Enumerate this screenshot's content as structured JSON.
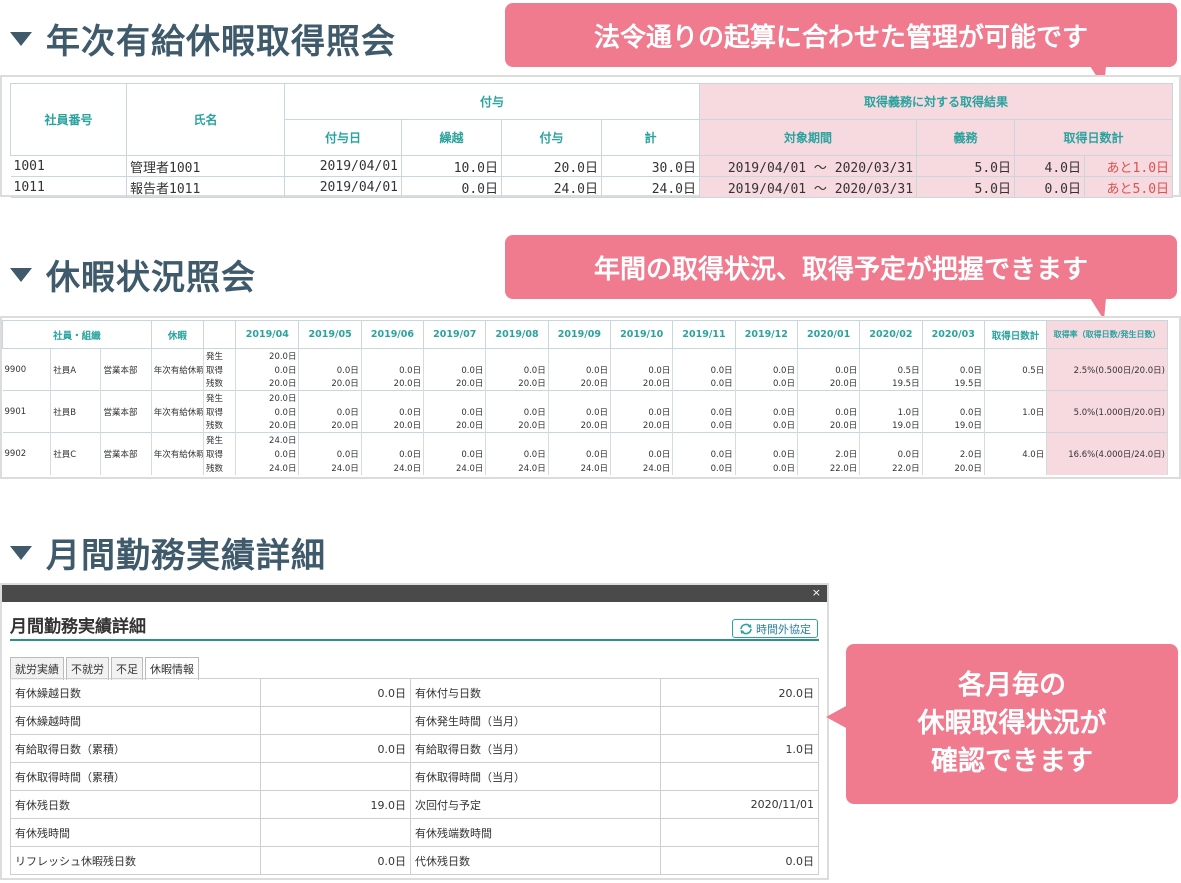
{
  "section1": {
    "title": "年次有給休暇取得照会",
    "callout": "法令通りの起算に合わせた管理が可能です",
    "headers": {
      "emp_no": "社員番号",
      "name": "氏名",
      "grant": "付与",
      "obligation_result": "取得義務に対する取得結果",
      "grant_date": "付与日",
      "carryover": "繰越",
      "granted": "付与",
      "total": "計",
      "period": "対象期間",
      "obligation": "義務",
      "taken_days": "取得日数計"
    },
    "rows": [
      {
        "emp_no": "1001",
        "name": "管理者1001",
        "grant_date": "2019/04/01",
        "carryover": "10.0日",
        "granted": "20.0日",
        "total": "30.0日",
        "period": "2019/04/01 ～ 2020/03/31",
        "obligation": "5.0日",
        "taken": "4.0日",
        "remaining": "あと1.0日"
      },
      {
        "emp_no": "1011",
        "name": "報告者1011",
        "grant_date": "2019/04/01",
        "carryover": "0.0日",
        "granted": "24.0日",
        "total": "24.0日",
        "period": "2019/04/01 ～ 2020/03/31",
        "obligation": "5.0日",
        "taken": "0.0日",
        "remaining": "あと5.0日"
      }
    ]
  },
  "section2": {
    "title": "休暇状況照会",
    "callout": "年間の取得状況、取得予定が把握できます",
    "headers": {
      "emp_org": "社員・組織",
      "leave": "休暇",
      "months": [
        "2019/04",
        "2019/05",
        "2019/06",
        "2019/07",
        "2019/08",
        "2019/09",
        "2019/10",
        "2019/11",
        "2019/12",
        "2020/01",
        "2020/02",
        "2020/03"
      ],
      "taken_total": "取得日数計",
      "rate": "取得率（取得日数/発生日数）"
    },
    "row_labels": [
      "発生",
      "取得",
      "残数"
    ],
    "employees": [
      {
        "code": "9900",
        "name": "社員A",
        "dept": "営業本部",
        "leave": "年次有給休暇",
        "occur": [
          "20.0日",
          "",
          "",
          "",
          "",
          "",
          "",
          "",
          "",
          "",
          "",
          ""
        ],
        "taken": [
          "0.0日",
          "0.0日",
          "0.0日",
          "0.0日",
          "0.0日",
          "0.0日",
          "0.0日",
          "0.0日",
          "0.0日",
          "0.0日",
          "0.5日",
          "0.0日"
        ],
        "remain": [
          "20.0日",
          "20.0日",
          "20.0日",
          "20.0日",
          "20.0日",
          "20.0日",
          "20.0日",
          "0.0日",
          "0.0日",
          "20.0日",
          "19.5日",
          "19.5日"
        ],
        "taken_total": "0.5日",
        "rate": "2.5%(0.500日/20.0日)"
      },
      {
        "code": "9901",
        "name": "社員B",
        "dept": "営業本部",
        "leave": "年次有給休暇",
        "occur": [
          "20.0日",
          "",
          "",
          "",
          "",
          "",
          "",
          "",
          "",
          "",
          "",
          ""
        ],
        "taken": [
          "0.0日",
          "0.0日",
          "0.0日",
          "0.0日",
          "0.0日",
          "0.0日",
          "0.0日",
          "0.0日",
          "0.0日",
          "0.0日",
          "1.0日",
          "0.0日"
        ],
        "remain": [
          "20.0日",
          "20.0日",
          "20.0日",
          "20.0日",
          "20.0日",
          "20.0日",
          "20.0日",
          "0.0日",
          "0.0日",
          "20.0日",
          "19.0日",
          "19.0日"
        ],
        "taken_total": "1.0日",
        "rate": "5.0%(1.000日/20.0日)"
      },
      {
        "code": "9902",
        "name": "社員C",
        "dept": "営業本部",
        "leave": "年次有給休暇",
        "occur": [
          "24.0日",
          "",
          "",
          "",
          "",
          "",
          "",
          "",
          "",
          "",
          "",
          ""
        ],
        "taken": [
          "0.0日",
          "0.0日",
          "0.0日",
          "0.0日",
          "0.0日",
          "0.0日",
          "0.0日",
          "0.0日",
          "0.0日",
          "2.0日",
          "0.0日",
          "2.0日"
        ],
        "remain": [
          "24.0日",
          "24.0日",
          "24.0日",
          "24.0日",
          "24.0日",
          "24.0日",
          "24.0日",
          "0.0日",
          "0.0日",
          "22.0日",
          "22.0日",
          "20.0日"
        ],
        "taken_total": "4.0日",
        "rate": "16.6%(4.000日/24.0日)"
      }
    ]
  },
  "section3": {
    "title": "月間勤務実績詳細",
    "callout_lines": [
      "各月毎の",
      "休暇取得状況が",
      "確認できます"
    ],
    "window": {
      "close": "×",
      "title": "月間勤務実績詳細",
      "overtime_button": "時間外協定",
      "tabs": [
        "就労実績",
        "不就労",
        "不足",
        "休暇情報"
      ],
      "rows": [
        [
          "有休繰越日数",
          "0.0日",
          "有休付与日数",
          "20.0日"
        ],
        [
          "有休繰越時間",
          "",
          "有休発生時間（当月）",
          ""
        ],
        [
          "有給取得日数（累積）",
          "0.0日",
          "有給取得日数（当月）",
          "1.0日"
        ],
        [
          "有休取得時間（累積）",
          "",
          "有休取得時間（当月）",
          ""
        ],
        [
          "有休残日数",
          "19.0日",
          "次回付与予定",
          "2020/11/01"
        ],
        [
          "有休残時間",
          "",
          "有休残端数時間",
          ""
        ],
        [
          "リフレッシュ休暇残日数",
          "0.0日",
          "代休残日数",
          "0.0日"
        ]
      ]
    }
  },
  "colors": {
    "accent": "#2aa39e",
    "heading": "#3f5a6b",
    "callout": "#f07a8e",
    "highlight": "#f7d9e0",
    "warning": "#d9534f"
  },
  "icons": {
    "section_marker": "triangle-down-icon",
    "refresh": "refresh-icon"
  }
}
